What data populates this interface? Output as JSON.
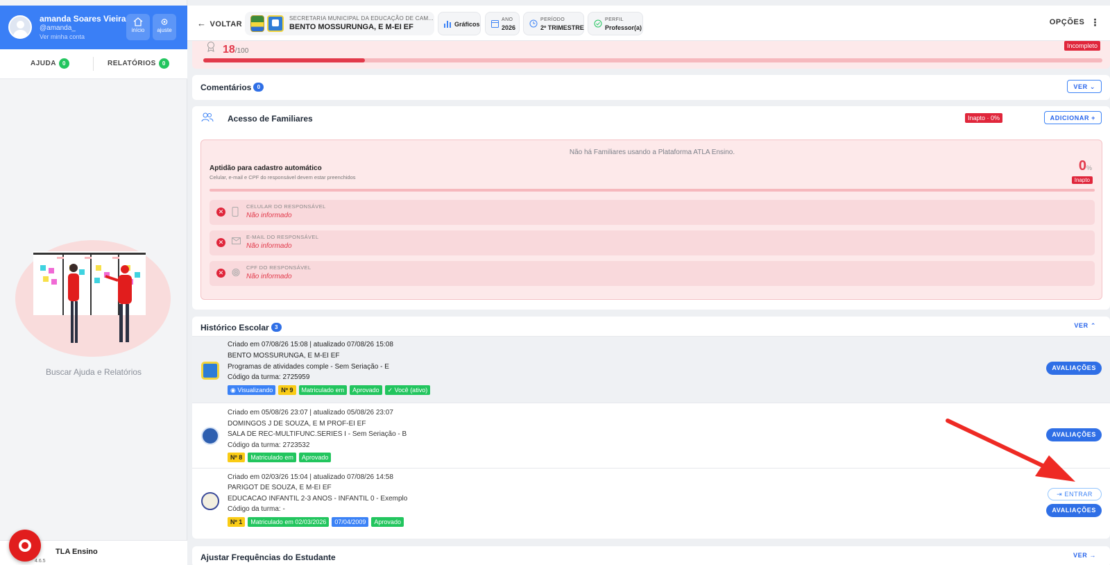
{
  "user": {
    "name": "amanda Soares Vieira",
    "handle": "@amanda_",
    "link": "Ver minha conta"
  },
  "user_buttons": [
    {
      "label": "início",
      "icon": "home-icon"
    },
    {
      "label": "ajuste",
      "icon": "gear-icon"
    }
  ],
  "sidebar_tabs": [
    {
      "label": "AJUDA",
      "count": "0"
    },
    {
      "label": "RELATÓRIOS",
      "count": "0"
    }
  ],
  "sidebar_help": "Buscar Ajuda e Relatórios",
  "sidebar_footer": {
    "brand": "TLA Ensino",
    "version": "4.6.5"
  },
  "topbar": {
    "back": "VOLTAR",
    "secretaria": "SECRETARIA MUNICIPAL DA EDUCAÇÃO DE CAM...",
    "school": "BENTO MOSSURUNGA, E M-EI EF",
    "graficos": "Gráficos",
    "ano_label": "ANO",
    "ano_value": "2026",
    "periodo_label": "PERÍODO",
    "periodo_value": "2º TRIMESTRE",
    "perfil_label": "PERFIL",
    "perfil_value": "Professor(a)",
    "options": "OPÇÕES"
  },
  "score": {
    "value": "18",
    "max": "/100",
    "status": "Incompleto",
    "progress": 0.18
  },
  "comments": {
    "title": "Comentários",
    "count": "0",
    "button": "VER"
  },
  "family": {
    "title": "Acesso de Familiares",
    "status_badge": "Inapto · 0%",
    "add_button": "ADICIONAR +",
    "empty": "Não há Familiares usando a Plataforma ATLA Ensino.",
    "aptidao_title": "Aptidão para cadastro automático",
    "aptidao_sub": "Celular, e-mail e CPF do responsável devem estar preenchidos",
    "percent": "0",
    "percent_unit": "%",
    "inapto": "Inapto",
    "requirements": [
      {
        "label": "CELULAR DO RESPONSÁVEL",
        "value": "Não informado",
        "icon": "phone-icon"
      },
      {
        "label": "E-MAIL DO RESPONSÁVEL",
        "value": "Não informado",
        "icon": "mail-icon"
      },
      {
        "label": "CPF DO RESPONSÁVEL",
        "value": "Não informado",
        "icon": "fingerprint-icon"
      }
    ]
  },
  "history": {
    "title": "Histórico Escolar",
    "count": "3",
    "button": "VER",
    "rows": [
      {
        "created": "Criado em 07/08/26 15:08 | atualizado 07/08/26 15:08",
        "school": "BENTO MOSSURUNGA, E M-EI EF",
        "class": "Programas de atividades comple - Sem Seriação - E",
        "code": "Código da turma: 2725959",
        "pills": [
          "Visualizando",
          "Nº 9",
          "Matriculado em",
          "Aprovado",
          "Você (ativo)"
        ],
        "button": "AVALIAÇÕES"
      },
      {
        "created": "Criado em 05/08/26 23:07 | atualizado 05/08/26 23:07",
        "school": "DOMINGOS J DE SOUZA, E M PROF-EI EF",
        "class": "SALA DE REC-MULTIFUNC.SERIES I - Sem Seriação - B",
        "code": "Código da turma: 2723532",
        "pills": [
          "Nº 8",
          "Matriculado em",
          "Aprovado"
        ],
        "button": "AVALIAÇÕES"
      },
      {
        "created": "Criado em 02/03/26 15:04 | atualizado 07/08/26 14:58",
        "school": "PARIGOT DE SOUZA, E M-EI EF",
        "class": "EDUCACAO INFANTIL 2-3 ANOS - INFANTIL 0 - Exemplo",
        "code": "Código da turma: -",
        "pills": [
          "Nº 1",
          "Matriculado em 02/03/2026",
          "07/04/2009",
          "Aprovado"
        ],
        "enter_button": "ENTRAR",
        "button": "AVALIAÇÕES"
      }
    ]
  },
  "frequencias": {
    "title": "Ajustar Frequências do Estudante",
    "button": "VER →"
  },
  "colors": {
    "primary": "#3a7ff6",
    "danger": "#e0263b",
    "success": "#22c55e",
    "warning": "#facc15"
  }
}
